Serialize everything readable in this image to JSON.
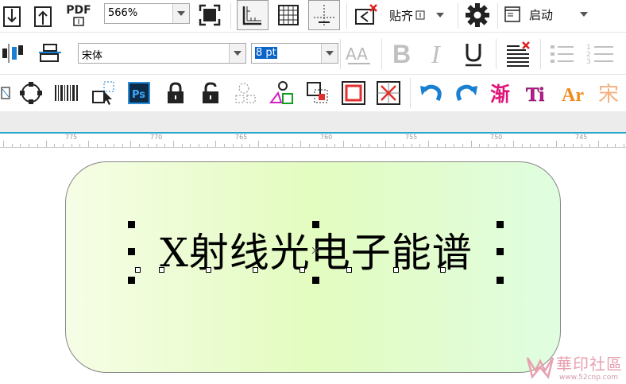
{
  "toolbar_top": {
    "pdf_label": "PDF",
    "zoom_value": "566%",
    "snap_label": "贴齐",
    "launch_label": "启动"
  },
  "text_toolbar": {
    "font_name": "宋体",
    "font_size": "8 pt"
  },
  "ruler": {
    "labels": [
      "775",
      "770",
      "765",
      "760",
      "755",
      "750",
      "745"
    ]
  },
  "canvas": {
    "caption": "X射线光电子能谱",
    "gradient_colors": [
      "#f6fde6",
      "#e3fcc0",
      "#e0fde0"
    ]
  },
  "watermark": {
    "text": "華印社區",
    "url": "www.52cnp.com"
  },
  "colors": {
    "accent_blue": "#1a7fd0",
    "magenta": "#e0157a",
    "orange": "#f08a1c",
    "teal_line": "#2aa6c9"
  }
}
